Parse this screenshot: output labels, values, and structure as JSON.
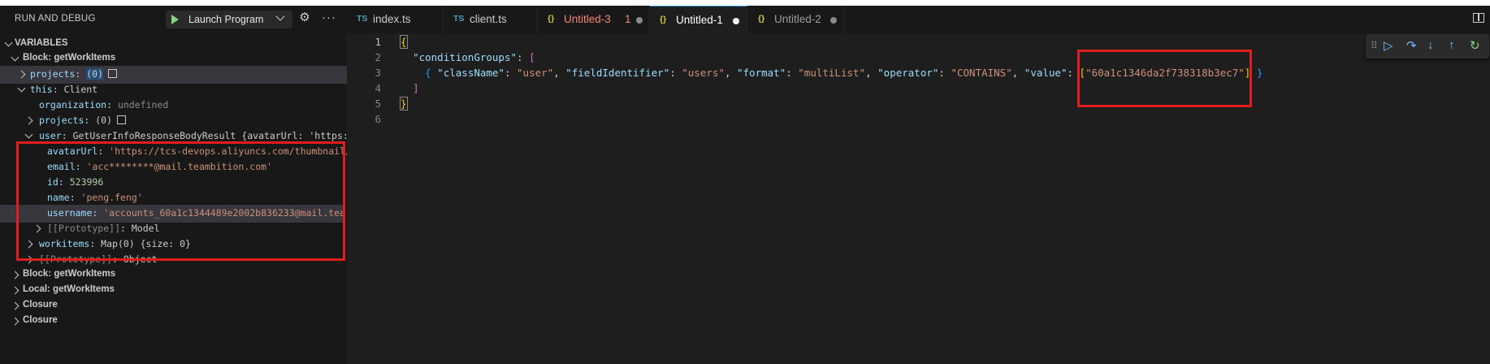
{
  "sidebar": {
    "title": "RUN AND DEBUG",
    "launch_config": "Launch Program",
    "section": "VARIABLES",
    "rows": [
      {
        "name": "Block: getWorkItems",
        "value": ""
      },
      {
        "name": "projects",
        "value": "(0)"
      },
      {
        "name": "this",
        "value": "Client"
      },
      {
        "name": "organization",
        "value": "undefined"
      },
      {
        "name": "projects",
        "value": "(0)"
      },
      {
        "name": "user",
        "value": "GetUserInfoResponseBodyResult {avatarUrl: 'https:/…"
      },
      {
        "name": "avatarUrl",
        "value": "'https://tcs-devops.aliyuncs.com/thumbnail/…"
      },
      {
        "name": "email",
        "value": "'acc********@mail.teambition.com'"
      },
      {
        "name": "id",
        "value": "523996"
      },
      {
        "name": "name",
        "value": "'peng.feng'"
      },
      {
        "name": "username",
        "value": "'accounts_60a1c1344489e2002b836233@mail.tea…"
      },
      {
        "name": "[[Prototype]]",
        "value": "Model"
      },
      {
        "name": "workitems",
        "value": "Map(0) {size: 0}"
      },
      {
        "name": "[[Prototype]]",
        "value": "Object"
      },
      {
        "name": "Block: getWorkItems",
        "value": ""
      },
      {
        "name": "Local: getWorkItems",
        "value": ""
      },
      {
        "name": "Closure",
        "value": ""
      },
      {
        "name": "Closure",
        "value": ""
      }
    ]
  },
  "tabs": [
    {
      "icon": "TS",
      "label": "index.ts",
      "badge": ""
    },
    {
      "icon": "TS",
      "label": "client.ts",
      "badge": ""
    },
    {
      "icon": "{}",
      "label": "Untitled-3",
      "badge": "1"
    },
    {
      "icon": "{}",
      "label": "Untitled-1",
      "badge": ""
    },
    {
      "icon": "{}",
      "label": "Untitled-2",
      "badge": ""
    }
  ],
  "editor": {
    "line_numbers": [
      "1",
      "2",
      "3",
      "4",
      "5",
      "6"
    ],
    "tokens": {
      "open_brace": "{",
      "k_conditionGroups": "\"conditionGroups\"",
      "colon_bracket": ": ",
      "open_bracket": "[",
      "open_brace_inner": "{",
      "k_className": "\"className\"",
      "v_user": "\"user\"",
      "k_fieldIdentifier": "\"fieldIdentifier\"",
      "v_users": "\"users\"",
      "k_format": "\"format\"",
      "v_multiList": "\"multiList\"",
      "k_operator": "\"operator\"",
      "v_contains": "\"CONTAINS\"",
      "k_value": "\"value\"",
      "v_array_open": "[",
      "v_id": "\"60a1c1346da2f738318b3ec7\"",
      "v_array_close": "]",
      "close_brace_inner": "}",
      "close_bracket": "]",
      "close_brace": "}"
    }
  },
  "colors": {
    "highlight_box": "#e11d1d",
    "modified_tab": "#f48771"
  }
}
